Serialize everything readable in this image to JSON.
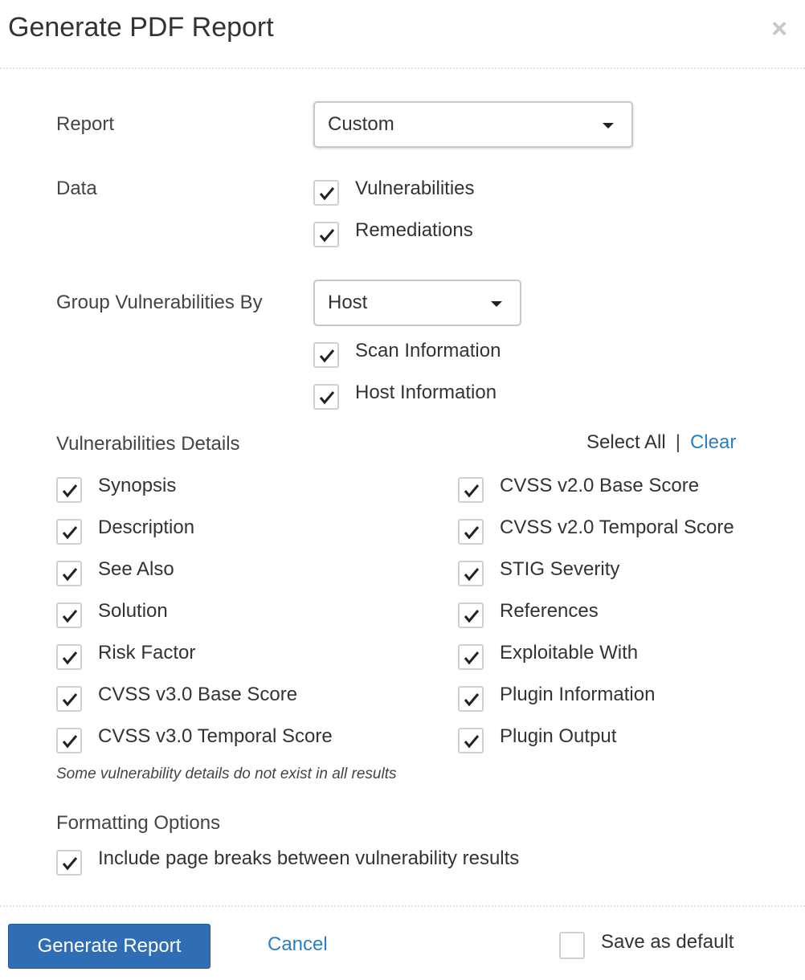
{
  "dialog": {
    "title": "Generate PDF Report",
    "close_glyph": "×"
  },
  "form": {
    "report_label": "Report",
    "report_value": "Custom",
    "data_label": "Data",
    "data_options": [
      {
        "label": "Vulnerabilities",
        "checked": true
      },
      {
        "label": "Remediations",
        "checked": true
      }
    ],
    "group_label": "Group Vulnerabilities By",
    "group_value": "Host",
    "group_options": [
      {
        "label": "Scan Information",
        "checked": true
      },
      {
        "label": "Host Information",
        "checked": true
      }
    ]
  },
  "details": {
    "heading": "Vulnerabilities Details",
    "select_all": "Select All",
    "separator": "|",
    "clear": "Clear",
    "left": [
      {
        "label": "Synopsis",
        "checked": true
      },
      {
        "label": "Description",
        "checked": true
      },
      {
        "label": "See Also",
        "checked": true
      },
      {
        "label": "Solution",
        "checked": true
      },
      {
        "label": "Risk Factor",
        "checked": true
      },
      {
        "label": "CVSS v3.0 Base Score",
        "checked": true
      },
      {
        "label": "CVSS v3.0 Temporal Score",
        "checked": true
      }
    ],
    "right": [
      {
        "label": "CVSS v2.0 Base Score",
        "checked": true
      },
      {
        "label": "CVSS v2.0 Temporal Score",
        "checked": true
      },
      {
        "label": "STIG Severity",
        "checked": true
      },
      {
        "label": "References",
        "checked": true
      },
      {
        "label": "Exploitable With",
        "checked": true
      },
      {
        "label": "Plugin Information",
        "checked": true
      },
      {
        "label": "Plugin Output",
        "checked": true
      }
    ],
    "note": "Some vulnerability details do not exist in all results"
  },
  "formatting": {
    "heading": "Formatting Options",
    "options": [
      {
        "label": "Include page breaks between vulnerability results",
        "checked": true
      }
    ]
  },
  "footer": {
    "generate_label": "Generate Report",
    "cancel_label": "Cancel",
    "save_default_label": "Save as default",
    "save_default_checked": false
  },
  "colors": {
    "primary_button": "#2f6db5",
    "link": "#2a7fc4",
    "close_icon": "#c8c8c8",
    "checkbox_border": "#d0d0d0"
  },
  "icons": {
    "close": "close-icon",
    "dropdown": "caret-down-icon",
    "check": "checkmark-icon"
  }
}
